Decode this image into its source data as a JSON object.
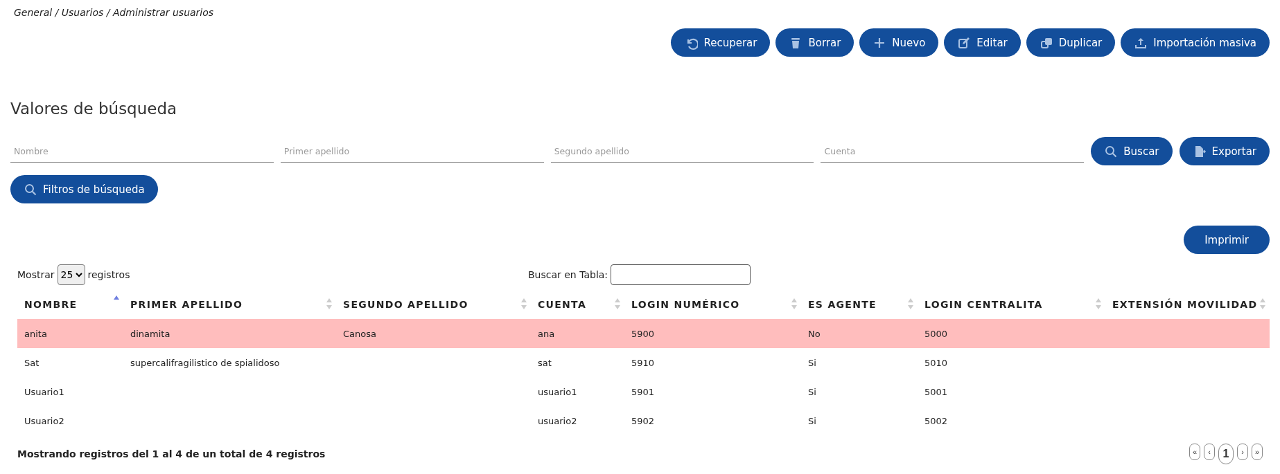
{
  "breadcrumb": "General / Usuarios / Administrar usuarios",
  "toolbar": [
    {
      "label": "Recuperar"
    },
    {
      "label": "Borrar"
    },
    {
      "label": "Nuevo"
    },
    {
      "label": "Editar"
    },
    {
      "label": "Duplicar"
    },
    {
      "label": "Importación masiva"
    }
  ],
  "search": {
    "title": "Valores de búsqueda",
    "fields": [
      {
        "placeholder": "Nombre"
      },
      {
        "placeholder": "Primer apellido"
      },
      {
        "placeholder": "Segundo apellido"
      },
      {
        "placeholder": "Cuenta"
      }
    ],
    "buttons": [
      {
        "label": "Buscar"
      },
      {
        "label": "Exportar"
      }
    ],
    "filters_button": {
      "label": "Filtros de búsqueda"
    }
  },
  "print_button": "Imprimir",
  "table": {
    "length_label_before": "Mostrar",
    "length_value": "25",
    "length_label_after": "registros",
    "filter_label": "Buscar en Tabla:",
    "columns": [
      {
        "label": "NOMBRE",
        "sorted": true
      },
      {
        "label": "PRIMER APELLIDO",
        "sorted": false
      },
      {
        "label": "SEGUNDO APELLIDO",
        "sorted": false
      },
      {
        "label": "CUENTA",
        "sorted": false
      },
      {
        "label": "LOGIN NUMÉRICO",
        "sorted": false
      },
      {
        "label": "ES AGENTE",
        "sorted": false
      },
      {
        "label": "LOGIN CENTRALITA",
        "sorted": false
      },
      {
        "label": "EXTENSIÓN MOVILIDAD",
        "sorted": false
      }
    ],
    "rows": [
      {
        "selected": true,
        "cells": [
          "anita",
          "dinamita",
          "Canosa",
          "ana",
          "5900",
          "No",
          "5000",
          ""
        ]
      },
      {
        "selected": false,
        "cells": [
          "Sat",
          "supercalifragilistico de spialidoso",
          "",
          "sat",
          "5910",
          "Si",
          "5010",
          ""
        ]
      },
      {
        "selected": false,
        "cells": [
          "Usuario1",
          "",
          "",
          "usuario1",
          "5901",
          "Si",
          "5001",
          ""
        ]
      },
      {
        "selected": false,
        "cells": [
          "Usuario2",
          "",
          "",
          "usuario2",
          "5902",
          "Si",
          "5002",
          ""
        ]
      }
    ],
    "info": "Mostrando registros del 1 al 4 de un total de 4 registros",
    "pagination": [
      {
        "label": "«",
        "selected": false
      },
      {
        "label": "‹",
        "selected": false
      },
      {
        "label": "1",
        "selected": true
      },
      {
        "label": "›",
        "selected": false
      },
      {
        "label": "»",
        "selected": false
      }
    ]
  }
}
